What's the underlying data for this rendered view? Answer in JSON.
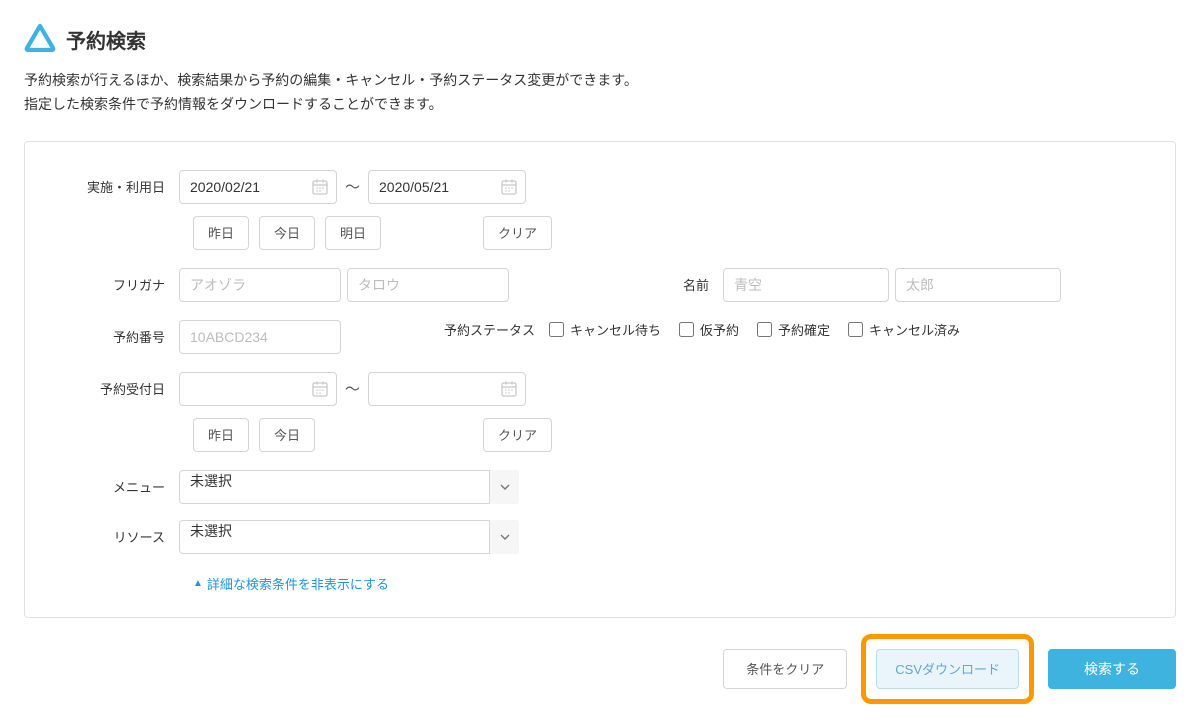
{
  "header": {
    "title": "予約検索"
  },
  "description": {
    "line1": "予約検索が行えるほか、検索結果から予約の編集・キャンセル・予約ステータス変更ができます。",
    "line2": "指定した検索条件で予約情報をダウンロードすることができます。"
  },
  "form": {
    "usage_date": {
      "label": "実施・利用日",
      "from": "2020/02/21",
      "to": "2020/05/21",
      "btn_yesterday": "昨日",
      "btn_today": "今日",
      "btn_tomorrow": "明日",
      "btn_clear": "クリア"
    },
    "furigana": {
      "label": "フリガナ",
      "placeholder_last": "アオゾラ",
      "placeholder_first": "タロウ"
    },
    "name": {
      "label": "名前",
      "placeholder_last": "青空",
      "placeholder_first": "太郎"
    },
    "booking_number": {
      "label": "予約番号",
      "placeholder": "10ABCD234"
    },
    "status": {
      "label": "予約ステータス",
      "opt_waitlist": "キャンセル待ち",
      "opt_provisional": "仮予約",
      "opt_confirmed": "予約確定",
      "opt_cancelled": "キャンセル済み"
    },
    "received_date": {
      "label": "予約受付日",
      "from": "",
      "to": "",
      "btn_yesterday": "昨日",
      "btn_today": "今日",
      "btn_clear": "クリア"
    },
    "menu": {
      "label": "メニュー",
      "value": "未選択"
    },
    "resource": {
      "label": "リソース",
      "value": "未選択"
    },
    "toggle_advanced": "詳細な検索条件を非表示にする"
  },
  "actions": {
    "clear": "条件をクリア",
    "csv": "CSVダウンロード",
    "search": "検索する"
  }
}
